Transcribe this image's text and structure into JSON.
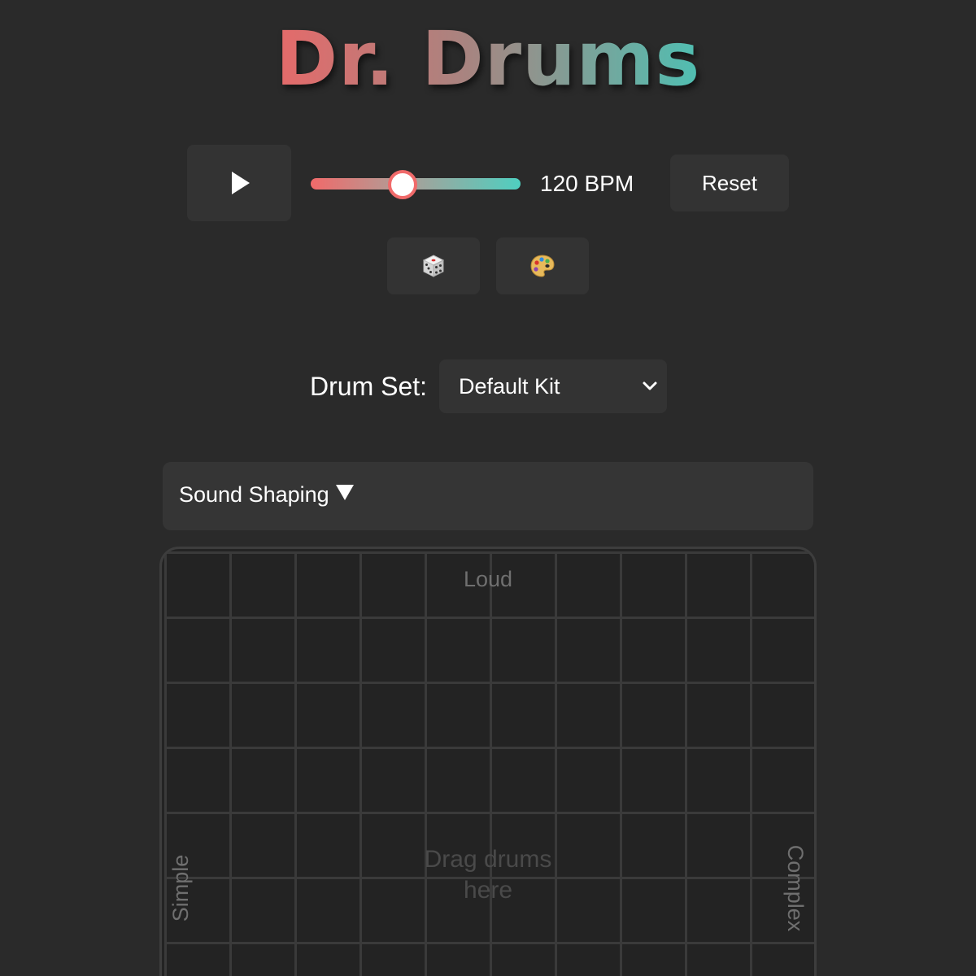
{
  "app": {
    "title": "Dr. Drums"
  },
  "transport": {
    "play_icon": "play-icon",
    "tempo_value": 120,
    "tempo_min": 40,
    "tempo_max": 240,
    "bpm_label": "120 BPM",
    "reset_label": "Reset"
  },
  "tools": {
    "randomize_icon": "dice-icon",
    "theme_icon": "palette-icon"
  },
  "drum_set": {
    "label": "Drum Set:",
    "selected": "Default Kit",
    "dropdown_icon": "chevron-down-icon"
  },
  "sound_shaping": {
    "label": "Sound Shaping",
    "toggle_icon": "triangle-down-icon"
  },
  "pad": {
    "top_label": "Loud",
    "left_label": "Simple",
    "right_label": "Complex",
    "hint_line1": "Drag drums",
    "hint_line2": "here"
  },
  "colors": {
    "background": "#2a2a2a",
    "title_gradient_start": "#e56a6a",
    "title_gradient_end": "#4fbfb2",
    "slider_start": "#f06a6a",
    "slider_end": "#4fcfc0",
    "button_bg": "#333333"
  }
}
